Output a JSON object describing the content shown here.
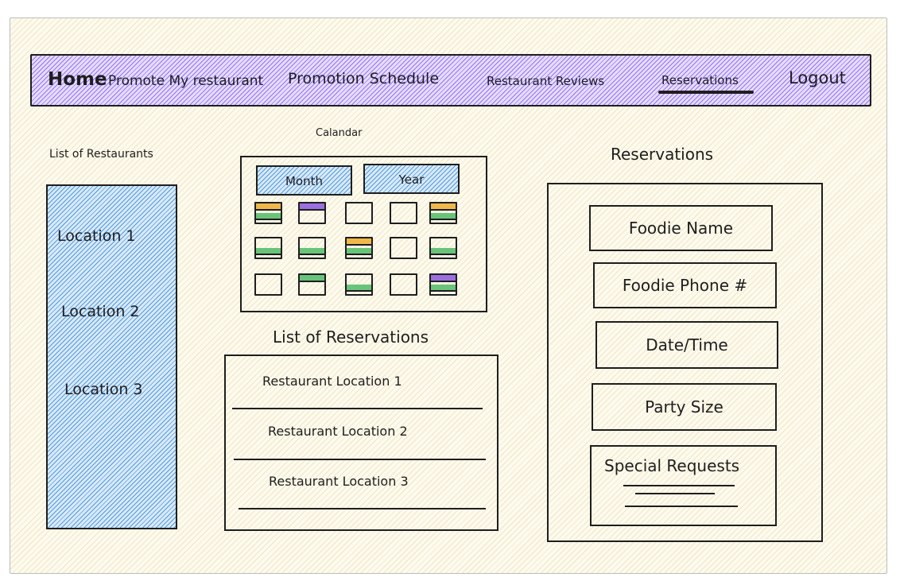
{
  "navbar": {
    "home": "Home",
    "promote": "Promote My restaurant",
    "schedule": "Promotion Schedule",
    "reviews": "Restaurant Reviews",
    "reservations": "Reservations",
    "logout": "Logout",
    "active": "Reservations"
  },
  "restaurants": {
    "title": "List of Restaurants",
    "locations": [
      "Location 1",
      "Location 2",
      "Location 3"
    ]
  },
  "calendar": {
    "title": "Calandar",
    "month_label": "Month",
    "year_label": "Year",
    "days": [
      {
        "stripes": [
          "orange",
          "green"
        ]
      },
      {
        "stripes": [
          "purple"
        ]
      },
      {
        "stripes": []
      },
      {
        "stripes": []
      },
      {
        "stripes": [
          "orange",
          "green"
        ]
      },
      {
        "stripes": [
          "none",
          "green"
        ]
      },
      {
        "stripes": [
          "none",
          "green"
        ]
      },
      {
        "stripes": [
          "orange",
          "green"
        ]
      },
      {
        "stripes": []
      },
      {
        "stripes": [
          "none",
          "green"
        ]
      },
      {
        "stripes": []
      },
      {
        "stripes": [
          "green"
        ]
      },
      {
        "stripes": [
          "none",
          "green"
        ]
      },
      {
        "stripes": []
      },
      {
        "stripes": [
          "purple",
          "green"
        ]
      }
    ]
  },
  "reservation_list": {
    "title": "List of Reservations",
    "items": [
      "Restaurant Location 1",
      "Restaurant Location 2",
      "Restaurant Location 3"
    ]
  },
  "reservation_form": {
    "title": "Reservations",
    "fields": {
      "name": "Foodie Name",
      "phone": "Foodie Phone #",
      "datetime": "Date/Time",
      "party": "Party Size",
      "requests": "Special Requests"
    }
  },
  "colors": {
    "nav_fill": "#7950f2",
    "panel_fill": "#1c7ed6",
    "stripe_orange": "#f0b84a",
    "stripe_green": "#69c47a",
    "stripe_purple": "#9c6fe0",
    "stroke": "#1e1e1e",
    "background": "#fdfaee"
  }
}
